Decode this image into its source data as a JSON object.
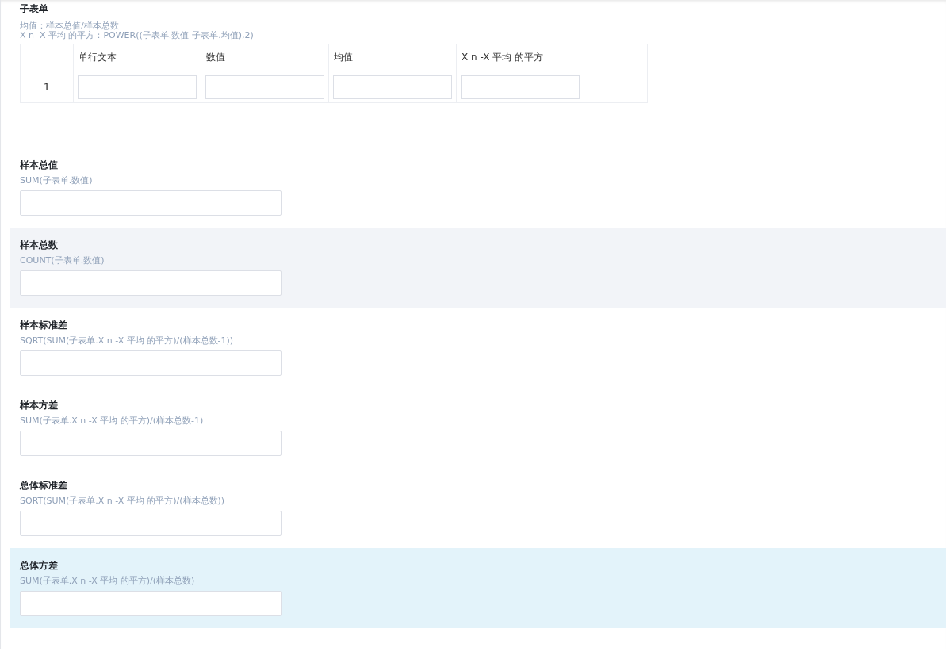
{
  "subform": {
    "title": "子表单",
    "hints": [
      "均值：样本总值/样本总数",
      "X n -X 平均 的平方：POWER((子表单.数值-子表单.均值),2)"
    ],
    "columns": [
      "单行文本",
      "数值",
      "均值",
      "X n -X 平均 的平方"
    ],
    "rows": [
      {
        "index": "1"
      }
    ]
  },
  "fields": [
    {
      "label": "样本总值",
      "formula": "SUM(子表单.数值)",
      "hovered": false,
      "selected": false
    },
    {
      "label": "样本总数",
      "formula": "COUNT(子表单.数值)",
      "hovered": true,
      "selected": false
    },
    {
      "label": "样本标准差",
      "formula": "SQRT(SUM(子表单.X n -X 平均 的平方)/(样本总数-1))",
      "hovered": false,
      "selected": false
    },
    {
      "label": "样本方差",
      "formula": "SUM(子表单.X n -X 平均 的平方)/(样本总数-1)",
      "hovered": false,
      "selected": false
    },
    {
      "label": "总体标准差",
      "formula": "SQRT(SUM(子表单.X n -X 平均 的平方)/(样本总数))",
      "hovered": false,
      "selected": false
    },
    {
      "label": "总体方差",
      "formula": "SUM(子表单.X n -X 平均 的平方)/(样本总数)",
      "hovered": false,
      "selected": true
    }
  ]
}
